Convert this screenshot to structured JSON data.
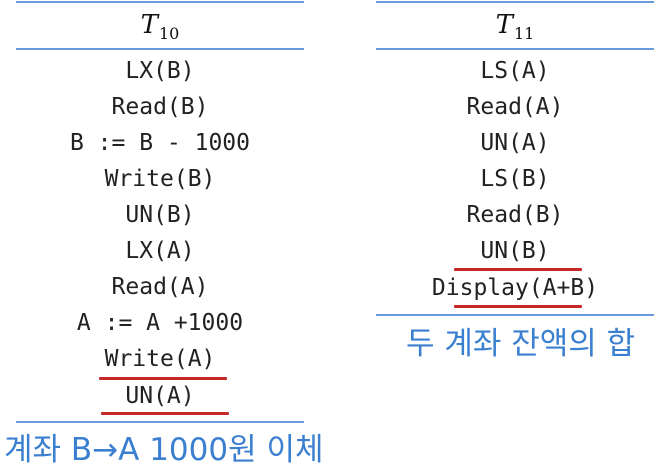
{
  "t10": {
    "head": "T",
    "sub": "10",
    "ops": [
      "LX(B)",
      "Read(B)",
      "B := B - 1000",
      "Write(B)",
      "UN(B)",
      "LX(A)",
      "Read(A)",
      "A := A +1000",
      "Write(A)",
      "UN(A)"
    ],
    "caption": "계좌 B→A 1000원 이체"
  },
  "t11": {
    "head": "T",
    "sub": "11",
    "ops": [
      "LS(A)",
      "Read(A)",
      "UN(A)",
      "LS(B)",
      "Read(B)",
      "UN(B)",
      "Display(A+B)"
    ],
    "caption": "두 계좌 잔액의 합"
  },
  "colors": {
    "rule": "#6a9bd8",
    "underline": "#c62828",
    "caption": "#3a7fd0"
  }
}
